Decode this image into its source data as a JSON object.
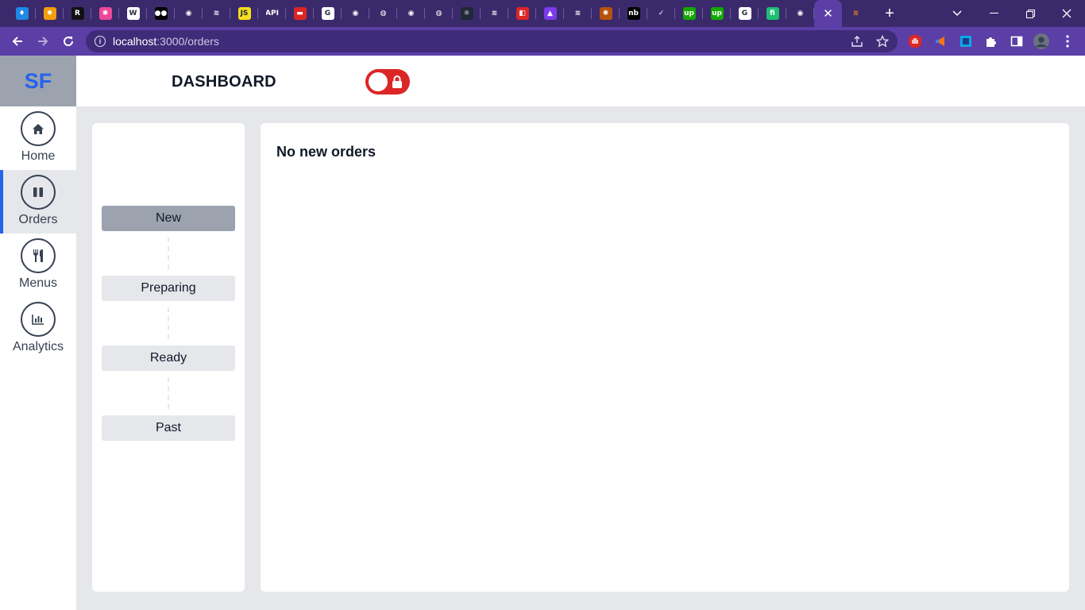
{
  "browser": {
    "tabs": [
      {
        "icon": "diamond-icon",
        "color": "#1e88e5",
        "glyph": "♦"
      },
      {
        "icon": "gear-badge-icon",
        "color": "#f59e0b",
        "glyph": "✹"
      },
      {
        "icon": "r-logo-icon",
        "color": "#111111",
        "glyph": "R"
      },
      {
        "icon": "star-icon",
        "color": "#ec4899",
        "glyph": "✱"
      },
      {
        "icon": "wikipedia-icon",
        "color": "#ffffff",
        "glyph": "W"
      },
      {
        "icon": "medium-icon",
        "color": "#000000",
        "glyph": "●●"
      },
      {
        "icon": "github-icon",
        "color": "#3b2a6b",
        "glyph": "◉"
      },
      {
        "icon": "stackoverflow-icon",
        "color": "#3b2a6b",
        "glyph": "≋"
      },
      {
        "icon": "javascript-icon",
        "color": "#f7df1e",
        "glyph": "JS"
      },
      {
        "icon": "api-icon",
        "color": "#3b2a6b",
        "glyph": "API"
      },
      {
        "icon": "red-badge-icon",
        "color": "#dc2626",
        "glyph": "▬"
      },
      {
        "icon": "google-icon",
        "color": "#ffffff",
        "glyph": "G"
      },
      {
        "icon": "github-icon",
        "color": "#3b2a6b",
        "glyph": "◉"
      },
      {
        "icon": "globe-icon",
        "color": "#3b2a6b",
        "glyph": "◍"
      },
      {
        "icon": "github-icon",
        "color": "#3b2a6b",
        "glyph": "◉"
      },
      {
        "icon": "globe-icon",
        "color": "#3b2a6b",
        "glyph": "◍"
      },
      {
        "icon": "react-icon",
        "color": "#1f2937",
        "glyph": "⚛"
      },
      {
        "icon": "stackoverflow-icon",
        "color": "#3b2a6b",
        "glyph": "≋"
      },
      {
        "icon": "netlify-icon",
        "color": "#dc2626",
        "glyph": "◧"
      },
      {
        "icon": "rocket-icon",
        "color": "#7c3aed",
        "glyph": "▲"
      },
      {
        "icon": "stackoverflow-icon",
        "color": "#3b2a6b",
        "glyph": "≋"
      },
      {
        "icon": "bug-icon",
        "color": "#b45309",
        "glyph": "✺"
      },
      {
        "icon": "hashnode-icon",
        "color": "#000000",
        "glyph": "nb"
      },
      {
        "icon": "bird-icon",
        "color": "#3b2a6b",
        "glyph": "✓"
      },
      {
        "icon": "upwork-icon",
        "color": "#14a800",
        "glyph": "up"
      },
      {
        "icon": "upwork-icon",
        "color": "#14a800",
        "glyph": "up"
      },
      {
        "icon": "google-icon",
        "color": "#ffffff",
        "glyph": "G"
      },
      {
        "icon": "fiverr-icon",
        "color": "#1dbf73",
        "glyph": "fi"
      },
      {
        "icon": "github-icon",
        "color": "#3b2a6b",
        "glyph": "◉"
      }
    ],
    "active_tab": {
      "icon": "close-icon",
      "glyph": "✕"
    },
    "last_tab": {
      "icon": "stackoverflow-icon",
      "glyph": "≋"
    },
    "new_tab_glyph": "+",
    "url_host": "localhost",
    "url_path": ":3000/orders"
  },
  "app": {
    "logo": "SF",
    "title": "DASHBOARD",
    "nav": [
      {
        "label": "Home",
        "icon": "home-icon",
        "active": false
      },
      {
        "label": "Orders",
        "icon": "pause-icon",
        "active": true
      },
      {
        "label": "Menus",
        "icon": "utensils-icon",
        "active": false
      },
      {
        "label": "Analytics",
        "icon": "chart-icon",
        "active": false
      }
    ],
    "statuses": [
      {
        "label": "New",
        "active": true
      },
      {
        "label": "Preparing",
        "active": false
      },
      {
        "label": "Ready",
        "active": false
      },
      {
        "label": "Past",
        "active": false
      }
    ],
    "empty_message": "No new orders"
  }
}
